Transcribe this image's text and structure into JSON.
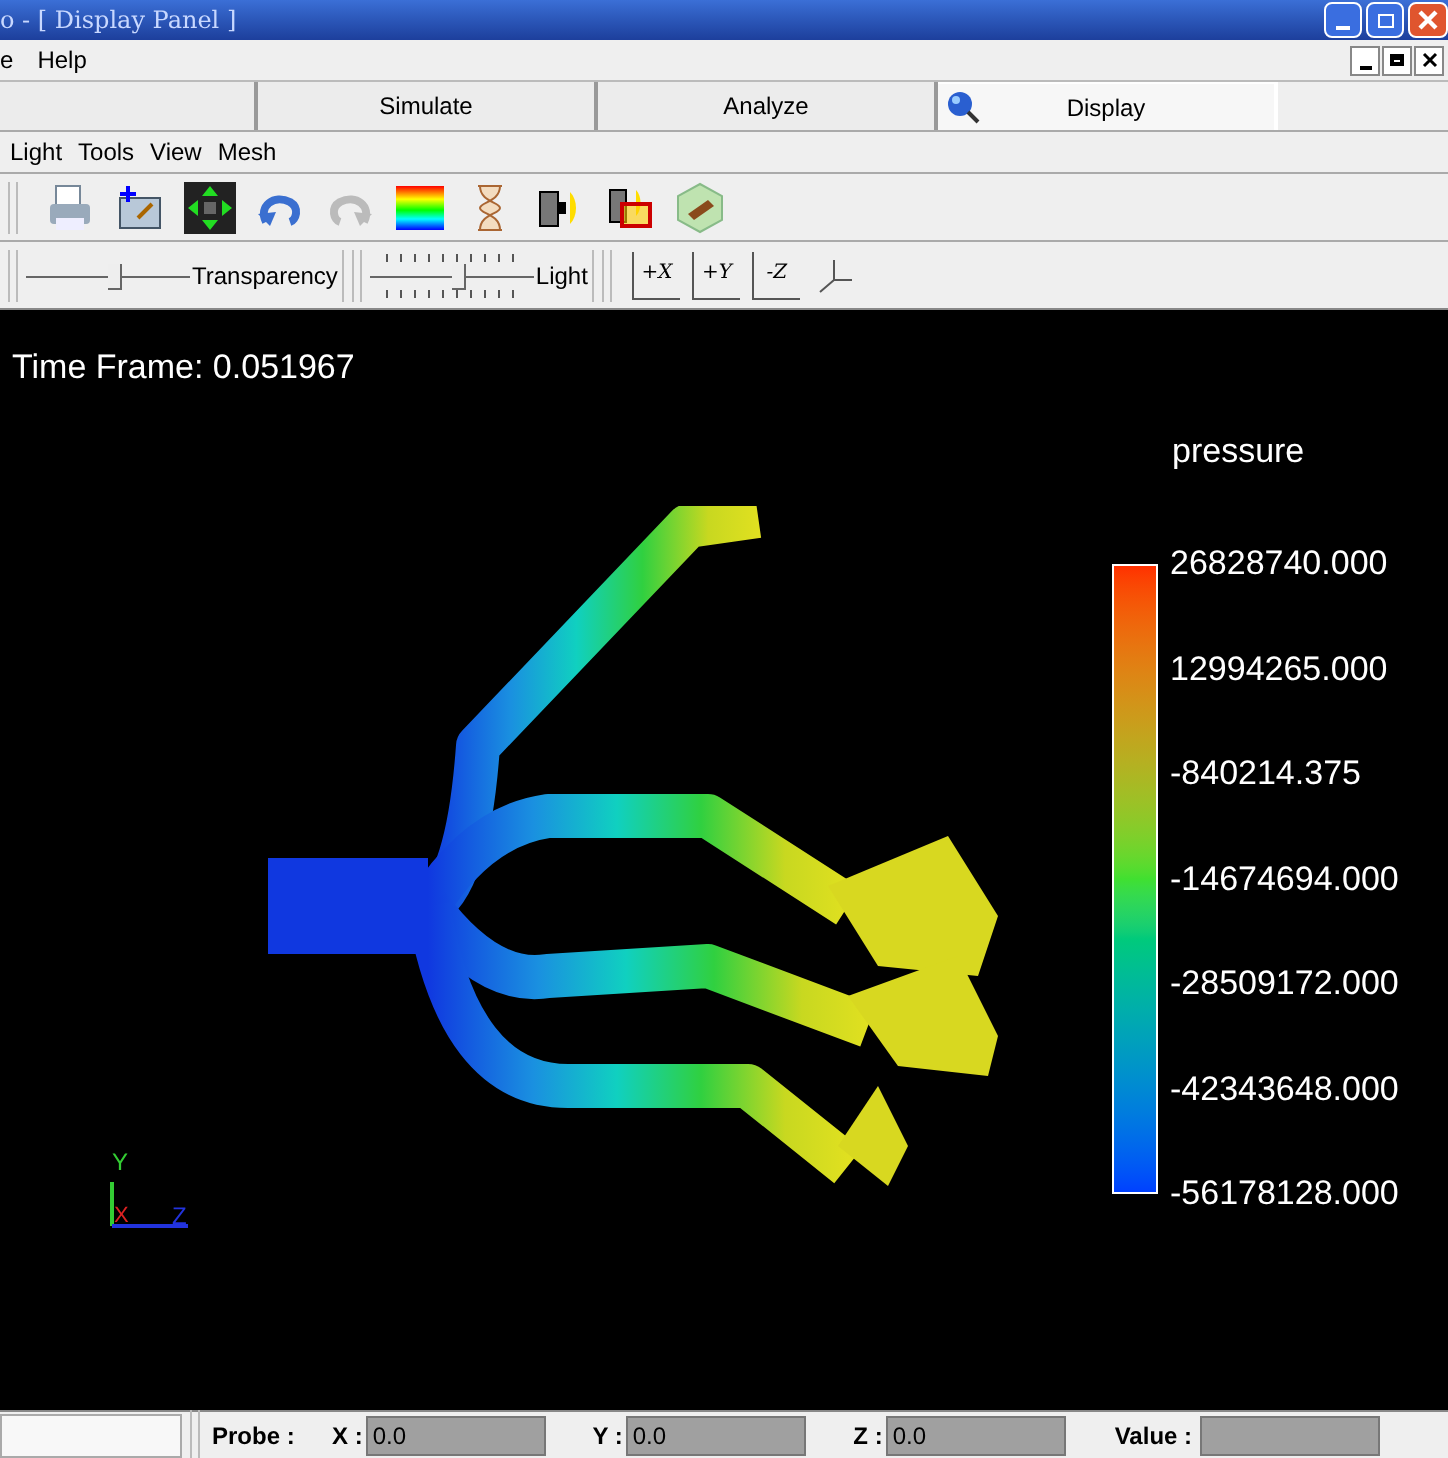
{
  "window": {
    "title": "o - [ Display Panel ]"
  },
  "menu_bar": [
    "e",
    "Help"
  ],
  "tabs": [
    {
      "selected": false
    },
    {
      "label": "Simulate",
      "selected": false
    },
    {
      "label": "Analyze",
      "selected": false
    },
    {
      "label": "Display",
      "selected": true
    }
  ],
  "panel_menu": [
    "Light",
    "Tools",
    "View",
    "Mesh"
  ],
  "toolbar": [
    {
      "kind": "print"
    },
    {
      "kind": "add"
    },
    {
      "kind": "move"
    },
    {
      "kind": "undo",
      "disabled": false
    },
    {
      "kind": "redo",
      "disabled": true
    },
    {
      "kind": "spectrum"
    },
    {
      "kind": "hourglass"
    },
    {
      "kind": "light"
    },
    {
      "kind": "lightbox"
    },
    {
      "kind": "hex"
    }
  ],
  "sliders": [
    {
      "label": "Transparency",
      "level": 0.55,
      "ticks": false
    },
    {
      "label": "Light",
      "level": 0.55,
      "ticks": true
    }
  ],
  "view_buttons": [
    "+X",
    "+Y",
    "-Z"
  ],
  "viewport": {
    "time_frame": "Time Frame: 0.051967",
    "legend_title": "pressure",
    "legend_values": [
      "26828740.000",
      "12994265.000",
      "-840214.375",
      "-14674694.000",
      "-28509172.000",
      "-42343648.000",
      "-56178128.000"
    ],
    "axes": [
      "Y",
      "X",
      "Z"
    ]
  },
  "status_bar": {
    "probe_label": "Probe :",
    "fields": [
      {
        "label": "X :",
        "value": "0.0"
      },
      {
        "label": "Y :",
        "value": "0.0"
      },
      {
        "label": "Z :",
        "value": "0.0"
      }
    ],
    "value_label": "Value :"
  }
}
